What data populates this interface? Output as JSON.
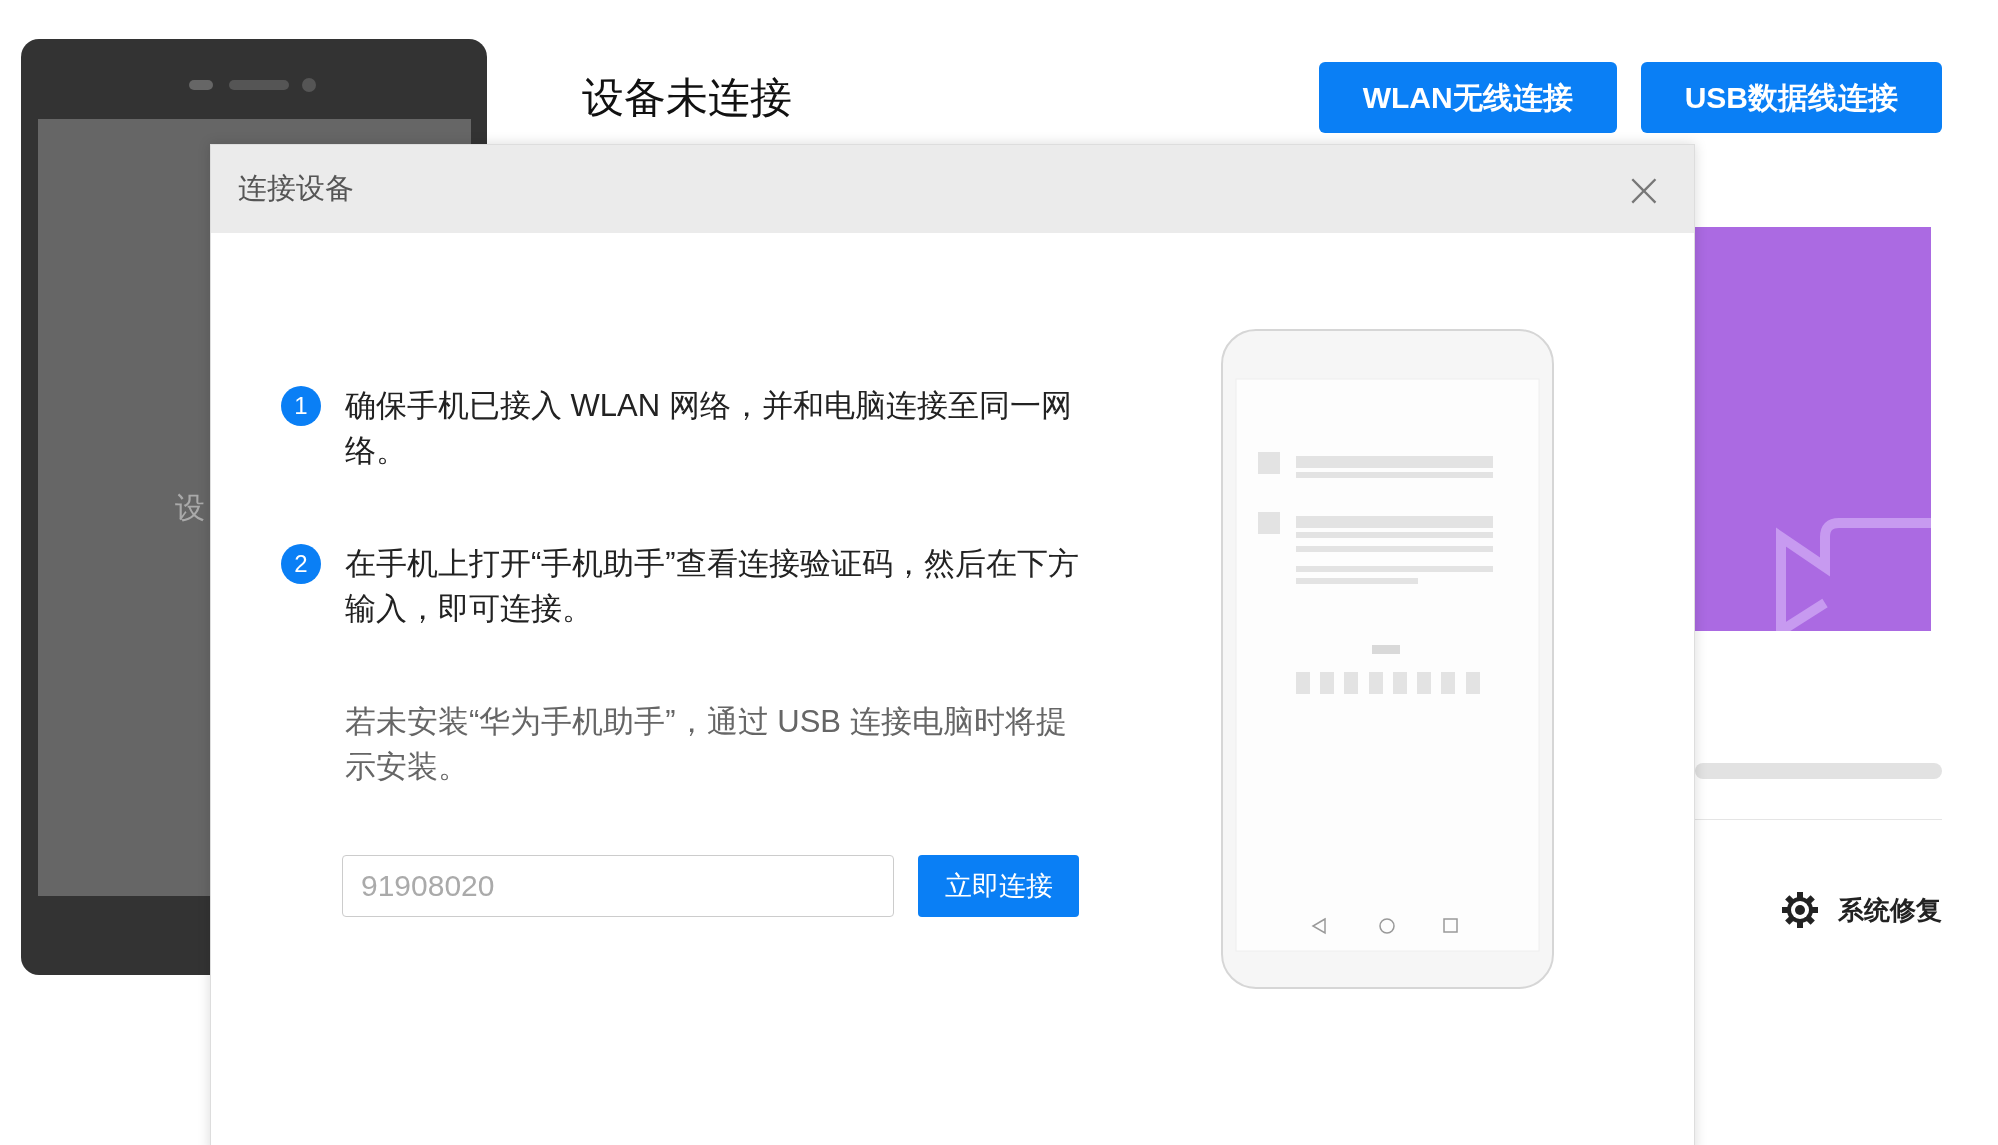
{
  "background": {
    "device_screen_text": "设",
    "title": "设备未连接",
    "buttons": [
      {
        "label": "WLAN无线连接"
      },
      {
        "label": "USB数据线连接"
      }
    ],
    "tool": {
      "label": "系统修复"
    }
  },
  "dialog": {
    "title": "连接设备",
    "close": "×",
    "steps": [
      {
        "number": "1",
        "text": "确保手机已接入 WLAN 网络，并和电脑连接至同一网络。"
      },
      {
        "number": "2",
        "text": "在手机上打开“手机助手”查看连接验证码，然后在下方输入，即可连接。"
      }
    ],
    "note": "若未安装“华为手机助手”，通过 USB 连接电脑时将提示安装。",
    "code_input": {
      "placeholder": "91908020"
    },
    "connect_button": "立即连接"
  }
}
